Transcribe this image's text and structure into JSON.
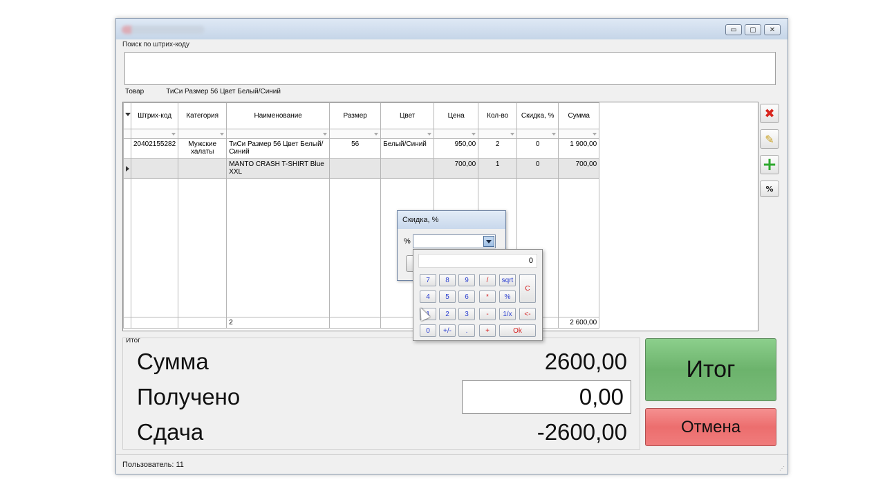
{
  "window": {
    "buttons": {
      "minimize": "▭",
      "maximize": "▢",
      "close": "✕"
    }
  },
  "barcode_search": {
    "label": "Поиск по штрих-коду",
    "value": ""
  },
  "product": {
    "label": "Товар",
    "value": "ТиСи Размер 56 Цвет Белый/Синий"
  },
  "grid": {
    "columns": [
      "Штрих-код",
      "Категория",
      "Наименование",
      "Размер",
      "Цвет",
      "Цена",
      "Кол-во",
      "Скидка, %",
      "Сумма"
    ],
    "rows": [
      {
        "barcode": "20402155282",
        "category": "Мужские халаты",
        "name": "ТиСи Размер 56 Цвет Белый/Синий",
        "size": "56",
        "color": "Белый/Синий",
        "price": "950,00",
        "qty": "2",
        "discount": "0",
        "sum": "1 900,00"
      },
      {
        "barcode": "",
        "category": "",
        "name": "MANTO CRASH T-SHIRT Blue XXL",
        "size": "",
        "color": "",
        "price": "700,00",
        "qty": "1",
        "discount": "0",
        "sum": "700,00"
      }
    ],
    "footer": {
      "name_count": "2",
      "sum_total": "2 600,00"
    }
  },
  "side_buttons": {
    "delete": "✖",
    "edit": "✎",
    "add": "+",
    "percent": "%"
  },
  "totals": {
    "group_label": "Итог",
    "sum_label": "Сумма",
    "sum_value": "2600,00",
    "received_label": "Получено",
    "received_value": "0,00",
    "change_label": "Сдача",
    "change_value": "-2600,00"
  },
  "actions": {
    "total": "Итог",
    "cancel": "Отмена"
  },
  "status": {
    "user": "Пользователь: 11"
  },
  "discount_dialog": {
    "title": "Скидка, %",
    "percent_label": "%",
    "value": ""
  },
  "calculator": {
    "display": "0",
    "keys": {
      "k7": "7",
      "k8": "8",
      "k9": "9",
      "div": "/",
      "sqrt": "sqrt",
      "clear": "C",
      "k4": "4",
      "k5": "5",
      "k6": "6",
      "mul": "*",
      "pct": "%",
      "k1": "1",
      "k2": "2",
      "k3": "3",
      "sub": "-",
      "inv": "1/x",
      "back": "<-",
      "k0": "0",
      "sign": "+/-",
      "dot": ".",
      "add": "+",
      "ok": "Ok"
    }
  }
}
